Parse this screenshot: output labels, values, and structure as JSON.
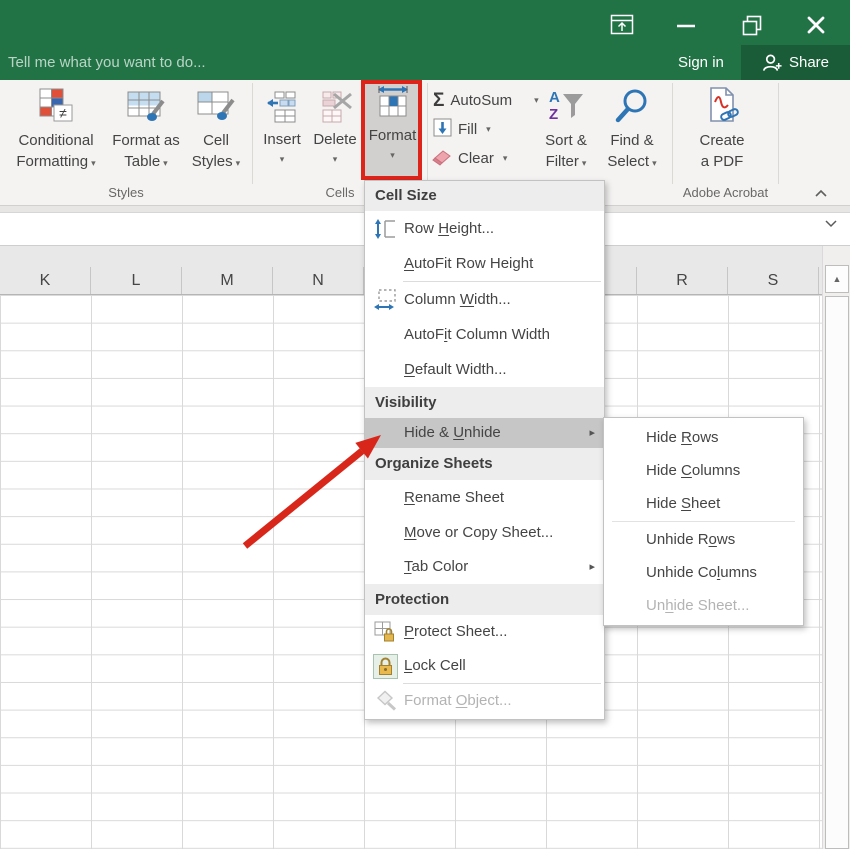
{
  "titlebar": {
    "tellme_placeholder": "Tell me what you want to do...",
    "sign_in_label": "Sign in",
    "share_label": "Share"
  },
  "ribbon": {
    "conditional_formatting_line1": "Conditional",
    "conditional_formatting_line2": "Formatting",
    "format_as_table_line1": "Format as",
    "format_as_table_line2": "Table",
    "cell_styles_line1": "Cell",
    "cell_styles_line2": "Styles",
    "insert_label": "Insert",
    "delete_label": "Delete",
    "format_label": "Format",
    "autosum_label": "AutoSum",
    "fill_label": "Fill",
    "clear_label": "Clear",
    "sort_filter_line1": "Sort &",
    "sort_filter_line2": "Filter",
    "find_select_line1": "Find &",
    "find_select_line2": "Select",
    "create_pdf_line1": "Create",
    "create_pdf_line2": "a PDF",
    "group_styles": "Styles",
    "group_cells": "Cells",
    "group_adobe": "Adobe Acrobat"
  },
  "grid": {
    "columns": [
      "K",
      "L",
      "M",
      "N",
      "",
      "",
      "",
      "R",
      "S"
    ]
  },
  "menu": {
    "header_cell_size": "Cell Size",
    "header_visibility": "Visibility",
    "header_organize": "Organize Sheets",
    "header_protection": "Protection",
    "row_height": {
      "pre": "Row ",
      "accel": "H",
      "post": "eight..."
    },
    "autofit_row_height": {
      "pre": "",
      "accel": "A",
      "post": "utoFit Row Height"
    },
    "column_width": {
      "pre": "Column ",
      "accel": "W",
      "post": "idth..."
    },
    "autofit_column_width": {
      "pre": "AutoF",
      "accel": "i",
      "post": "t Column Width"
    },
    "default_width": {
      "pre": "",
      "accel": "D",
      "post": "efault Width..."
    },
    "hide_unhide": {
      "pre": "Hide & ",
      "accel": "U",
      "post": "nhide"
    },
    "rename_sheet": {
      "pre": "",
      "accel": "R",
      "post": "ename Sheet"
    },
    "move_copy_sheet": {
      "pre": "",
      "accel": "M",
      "post": "ove or Copy Sheet..."
    },
    "tab_color": {
      "pre": "",
      "accel": "T",
      "post": "ab Color"
    },
    "protect_sheet": {
      "pre": "",
      "accel": "P",
      "post": "rotect Sheet..."
    },
    "lock_cell": {
      "pre": "",
      "accel": "L",
      "post": "ock Cell"
    },
    "format_object": {
      "pre": "Format ",
      "accel": "O",
      "post": "bject..."
    }
  },
  "submenu": {
    "hide_rows": {
      "pre": "Hide ",
      "accel": "R",
      "post": "ows"
    },
    "hide_columns": {
      "pre": "Hide ",
      "accel": "C",
      "post": "olumns"
    },
    "hide_sheet": {
      "pre": "Hide ",
      "accel": "S",
      "post": "heet"
    },
    "unhide_rows": {
      "pre": "Unhide R",
      "accel": "o",
      "post": "ws"
    },
    "unhide_columns": {
      "pre": "Unhide Co",
      "accel": "l",
      "post": "umns"
    },
    "unhide_sheet": {
      "pre": "Un",
      "accel": "h",
      "post": "ide Sheet..."
    }
  },
  "icons": {
    "dropdown_caret": "▾",
    "submenu_arrow": "▸",
    "scroll_up_triangle": "▲",
    "not_equal": "≠",
    "sigma": "Σ",
    "sort_a": "A",
    "sort_z": "Z"
  },
  "colors": {
    "excel_green": "#217346",
    "share_green": "#1a5c38",
    "annotation_red": "#dc241b",
    "menu_highlight": "#c6c6c6"
  }
}
